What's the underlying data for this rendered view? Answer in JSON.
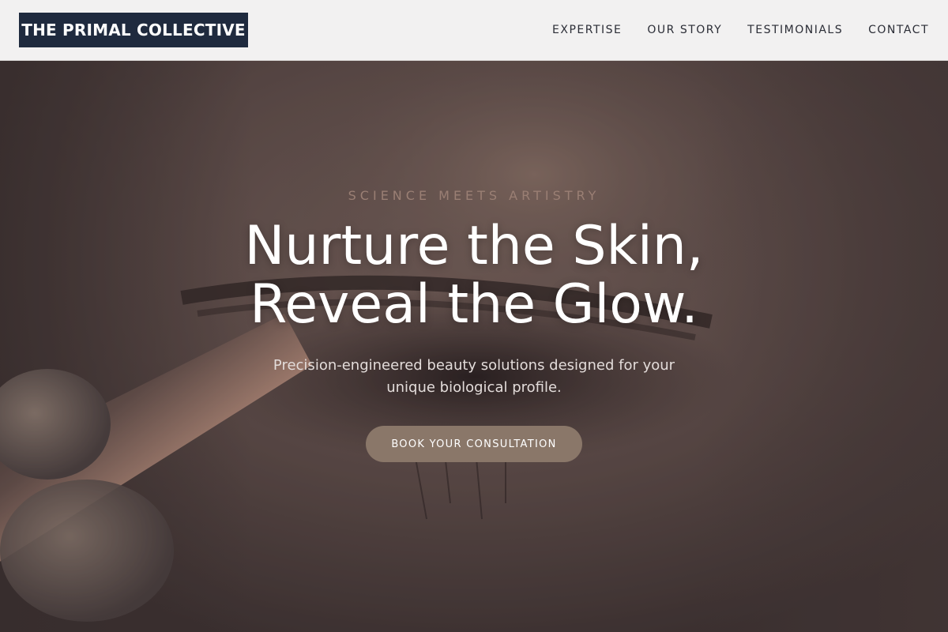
{
  "header": {
    "logo": "THE PRIMAL COLLECTIVE",
    "nav": [
      {
        "label": "EXPERTISE"
      },
      {
        "label": "OUR STORY"
      },
      {
        "label": "TESTIMONIALS"
      },
      {
        "label": "CONTACT"
      }
    ]
  },
  "hero": {
    "eyebrow": "SCIENCE MEETS ARTISTRY",
    "headline_line1": "Nurture the Skin,",
    "headline_line2": "Reveal the Glow.",
    "subtext": "Precision-engineered beauty solutions designed for your unique biological profile.",
    "cta_label": "BOOK YOUR CONSULTATION",
    "background_image": "close-up-eye-makeup-brush-photo"
  },
  "colors": {
    "logo_bg": "#1f2a3e",
    "header_bg": "#f2f1f1",
    "cta_bg": "#8a7769",
    "eyebrow": "#9a7f74",
    "headline": "#ffffff"
  }
}
